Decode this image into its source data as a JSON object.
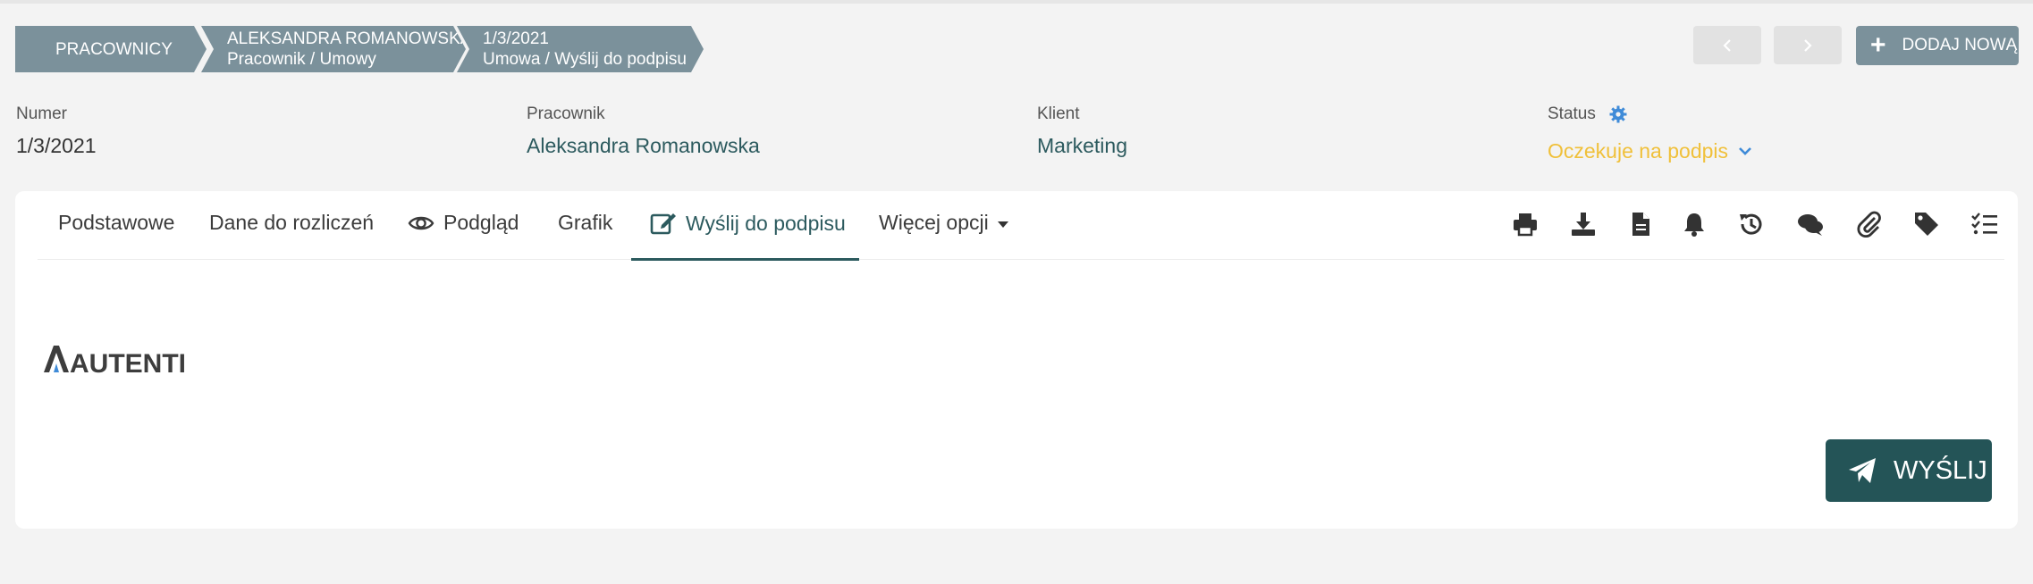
{
  "breadcrumb": [
    {
      "line1": "PRACOWNICY",
      "line2": ""
    },
    {
      "line1": "ALEKSANDRA ROMANOWSKA",
      "line2": "Pracownik / Umowy"
    },
    {
      "line1": "1/3/2021",
      "line2": "Umowa / Wyślij do podpisu"
    }
  ],
  "toolbar": {
    "prev_icon": "chevron-left-icon",
    "next_icon": "chevron-right-icon",
    "add_label": "DODAJ NOWĄ"
  },
  "fields": {
    "numer": {
      "label": "Numer",
      "value": "1/3/2021"
    },
    "pracownik": {
      "label": "Pracownik",
      "value": "Aleksandra Romanowska"
    },
    "klient": {
      "label": "Klient",
      "value": "Marketing"
    },
    "status": {
      "label": "Status",
      "value": "Oczekuje na podpis"
    }
  },
  "tabs": [
    {
      "label": "Podstawowe",
      "active": false
    },
    {
      "label": "Dane do rozliczeń",
      "active": false
    },
    {
      "label": "Podgląd",
      "active": false,
      "icon": "eye-icon"
    },
    {
      "label": "Grafik",
      "active": false
    },
    {
      "label": "Wyślij do podpisu",
      "active": true,
      "icon": "edit-icon"
    },
    {
      "label": "Więcej opcji",
      "active": false
    }
  ],
  "tool_icons": [
    "print-icon",
    "download-icon",
    "document-icon",
    "bell-icon",
    "history-icon",
    "comments-icon",
    "paperclip-icon",
    "tag-icon",
    "checklist-icon"
  ],
  "logo": {
    "text": "AUTENTI"
  },
  "send_button": {
    "label": "WYŚLIJ"
  },
  "colors": {
    "accent": "#2c5a5e",
    "breadcrumb": "#7b919b",
    "status": "#f0c03a",
    "send_button": "#245457"
  }
}
